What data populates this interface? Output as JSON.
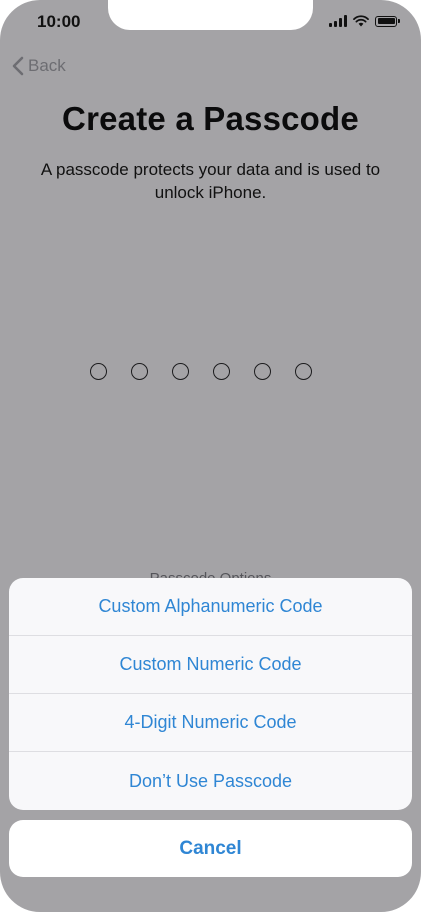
{
  "status_bar": {
    "time": "10:00"
  },
  "nav": {
    "back_label": "Back"
  },
  "screen": {
    "title": "Create a Passcode",
    "subtitle": "A passcode protects your data and is used to unlock iPhone.",
    "passcode_dots": 6,
    "options_link": "Passcode Options"
  },
  "action_sheet": {
    "items": [
      {
        "label": "Custom Alphanumeric Code"
      },
      {
        "label": "Custom Numeric Code"
      },
      {
        "label": "4-Digit Numeric Code"
      },
      {
        "label": "Don’t Use Passcode"
      }
    ],
    "cancel_label": "Cancel"
  },
  "colors": {
    "dimmed_background": "#a4a3a6",
    "accent": "#2f86d4",
    "sheet_background": "#f8f8fa"
  }
}
